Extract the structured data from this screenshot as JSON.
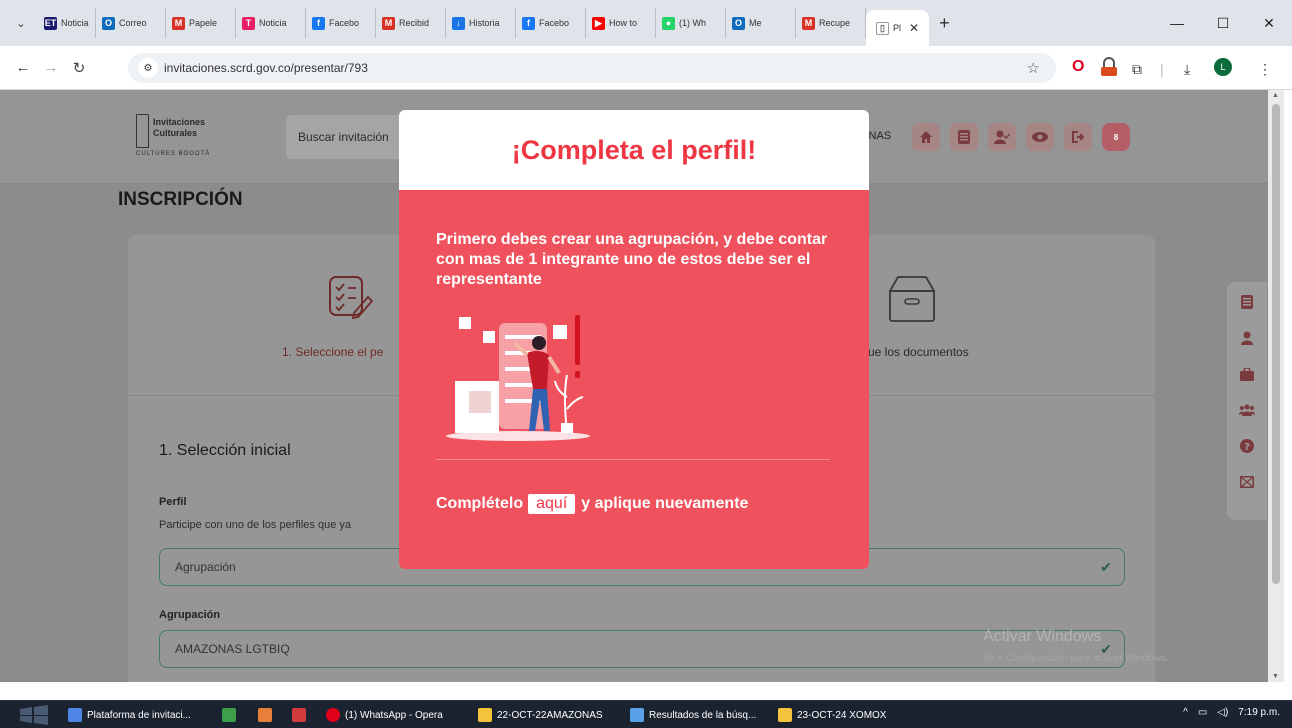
{
  "browser": {
    "tabs": [
      {
        "label": "Noticia",
        "favicon_text": "ET",
        "color": "#1a1a6e"
      },
      {
        "label": "Correo",
        "favicon_text": "O",
        "color": "#0f6cbd"
      },
      {
        "label": "Papele",
        "favicon_text": "M",
        "color": "#d93025"
      },
      {
        "label": "Noticia",
        "favicon_text": "T",
        "color": "#e91e63"
      },
      {
        "label": "Facebo",
        "favicon_text": "f",
        "color": "#1877f2"
      },
      {
        "label": "Recibid",
        "favicon_text": "M",
        "color": "#d93025"
      },
      {
        "label": "Historia",
        "favicon_text": "↓",
        "color": "#1a73e8"
      },
      {
        "label": "Facebo",
        "favicon_text": "f",
        "color": "#1877f2"
      },
      {
        "label": "How to",
        "favicon_text": "▶",
        "color": "#ff0000"
      },
      {
        "label": "(1) Wh",
        "favicon_text": "●",
        "color": "#25d366"
      },
      {
        "label": "Me",
        "favicon_text": "O",
        "color": "#0f6cbd"
      },
      {
        "label": "Recupe",
        "favicon_text": "M",
        "color": "#d93025"
      }
    ],
    "active_tab": {
      "label": "Pl"
    },
    "url": "invitaciones.scrd.gov.co/presentar/793",
    "profile_initial": "L"
  },
  "site": {
    "logo_line1": "Invitaciones",
    "logo_line2": "Culturales",
    "logo_line3": "CULTURES BOGOTÁ",
    "search_placeholder": "Buscar invitación",
    "user_label": "ONAS",
    "notification_count": "8"
  },
  "page": {
    "title": "INSCRIPCIÓN",
    "step1_label": "1. Seleccione el pe",
    "step3_label": "ue los documentos",
    "section_title": "1. Selección inicial",
    "perfil_label": "Perfil",
    "perfil_help": "Participe con uno de los perfiles que ya",
    "perfil_value": "Agrupación",
    "agrupacion_label": "Agrupación",
    "agrupacion_value": "AMAZONAS LGTBIQ",
    "watermark_title": "Activar Windows",
    "watermark_sub": "Ve a Configuración para activar Windows."
  },
  "modal": {
    "title": "¡Completa el perfil!",
    "message": "Primero debes crear una agrupación, y debe contar con mas de 1 integrante uno de estos debe ser el representante",
    "footer_before": "Complételo",
    "link_text": "aquí",
    "footer_after": "y aplique nuevamente",
    "accent_color": "#f0525d"
  },
  "taskbar": {
    "items": [
      "Plataforma de invitaci...",
      "(1) WhatsApp - Opera",
      "22-OCT-22AMAZONAS",
      "Resultados de la búsq...",
      "23-OCT-24 XOMOX"
    ],
    "clock": "7:19 p.m."
  }
}
